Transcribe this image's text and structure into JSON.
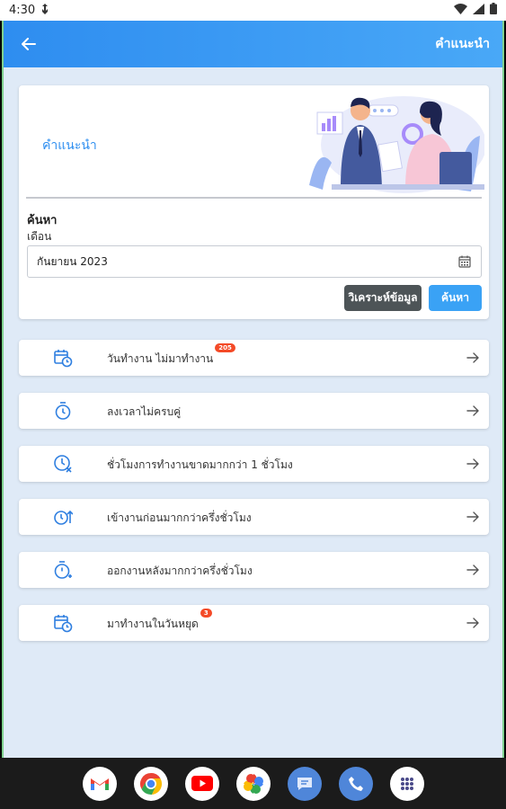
{
  "status_bar": {
    "time": "4:30"
  },
  "appbar": {
    "title": "คำแนะนำ"
  },
  "hero": {
    "title": "คำแนะนำ"
  },
  "search": {
    "section_title": "ค้นหา",
    "month_label": "เดือน",
    "month_value": "กันยายน 2023",
    "analyze_label": "วิเคราะห์ข้อมูล",
    "search_label": "ค้นหา"
  },
  "items": [
    {
      "label": "วันทำงาน ไม่มาทำงาน",
      "badge": "205",
      "icon": "calendar-clock-icon"
    },
    {
      "label": "ลงเวลาไม่ครบคู่",
      "badge": "",
      "icon": "timer-icon"
    },
    {
      "label": "ชั่วโมงการทำงานขาดมากกว่า 1 ชั่วโมง",
      "badge": "",
      "icon": "clock-x-icon"
    },
    {
      "label": "เข้างานก่อนมากกว่าครึ่งชั่วโมง",
      "badge": "",
      "icon": "clock-arrow-up-icon"
    },
    {
      "label": "ออกงานหลังมากกว่าครึ่งชั่วโมง",
      "badge": "",
      "icon": "timer-plus-icon"
    },
    {
      "label": "มาทำงานในวันหยุด",
      "badge": "3",
      "icon": "calendar-clock-icon"
    }
  ],
  "dock": [
    "gmail-icon",
    "chrome-icon",
    "youtube-icon",
    "photos-icon",
    "messages-icon",
    "phone-icon",
    "app-drawer-icon"
  ],
  "colors": {
    "appbar": "#2e8df0",
    "accent": "#3aa2f5",
    "background": "#dfeaf7",
    "badge": "#f44a27",
    "analyze_button": "#4d5457"
  }
}
